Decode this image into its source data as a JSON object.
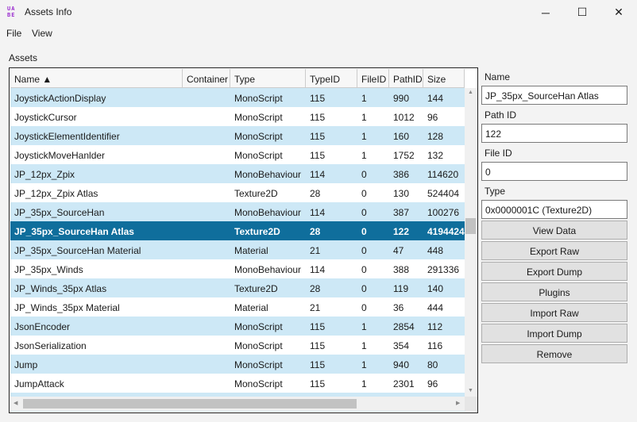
{
  "window": {
    "title": "Assets Info",
    "logo": "UABE",
    "minimize": "─",
    "maximize": "☐",
    "close": "✕"
  },
  "menu": [
    "File",
    "View"
  ],
  "assets_label": "Assets",
  "columns": [
    "Name ▲",
    "Container",
    "Type",
    "TypeID",
    "FileID",
    "PathID",
    "Size"
  ],
  "rows": [
    [
      "JoystickActionDisplay",
      "",
      "MonoScript",
      "115",
      "1",
      "990",
      "144"
    ],
    [
      "JoystickCursor",
      "",
      "MonoScript",
      "115",
      "1",
      "1012",
      "96"
    ],
    [
      "JoystickElementIdentifier",
      "",
      "MonoScript",
      "115",
      "1",
      "160",
      "128"
    ],
    [
      "JoystickMoveHanlder",
      "",
      "MonoScript",
      "115",
      "1",
      "1752",
      "132"
    ],
    [
      "JP_12px_Zpix",
      "",
      "MonoBehaviour",
      "114",
      "0",
      "386",
      "114620"
    ],
    [
      "JP_12px_Zpix Atlas",
      "",
      "Texture2D",
      "28",
      "0",
      "130",
      "524404"
    ],
    [
      "JP_35px_SourceHan",
      "",
      "MonoBehaviour",
      "114",
      "0",
      "387",
      "100276"
    ],
    [
      "JP_35px_SourceHan Atlas",
      "",
      "Texture2D",
      "28",
      "0",
      "122",
      "4194424"
    ],
    [
      "JP_35px_SourceHan Material",
      "",
      "Material",
      "21",
      "0",
      "47",
      "448"
    ],
    [
      "JP_35px_Winds",
      "",
      "MonoBehaviour",
      "114",
      "0",
      "388",
      "291336"
    ],
    [
      "JP_Winds_35px Atlas",
      "",
      "Texture2D",
      "28",
      "0",
      "119",
      "140"
    ],
    [
      "JP_Winds_35px Material",
      "",
      "Material",
      "21",
      "0",
      "36",
      "444"
    ],
    [
      "JsonEncoder",
      "",
      "MonoScript",
      "115",
      "1",
      "2854",
      "112"
    ],
    [
      "JsonSerialization",
      "",
      "MonoScript",
      "115",
      "1",
      "354",
      "116"
    ],
    [
      "Jump",
      "",
      "MonoScript",
      "115",
      "1",
      "940",
      "80"
    ],
    [
      "JumpAttack",
      "",
      "MonoScript",
      "115",
      "1",
      "2301",
      "96"
    ]
  ],
  "selected_index": 7,
  "colors": {
    "row_alt": "#cde8f6",
    "selected": "#0f6e9c",
    "logo": "#9b2fd0"
  },
  "details": {
    "name_label": "Name",
    "name_value": "JP_35px_SourceHan Atlas",
    "path_label": "Path ID",
    "path_value": "122",
    "file_label": "File ID",
    "file_value": "0",
    "type_label": "Type",
    "type_value": "0x0000001C (Texture2D)"
  },
  "buttons": [
    "View Data",
    "Export Raw",
    "Export Dump",
    "Plugins",
    "Import Raw",
    "Import Dump",
    "Remove"
  ],
  "scroll": {
    "up": "▲",
    "down": "▼",
    "left": "◀",
    "right": "▶"
  }
}
